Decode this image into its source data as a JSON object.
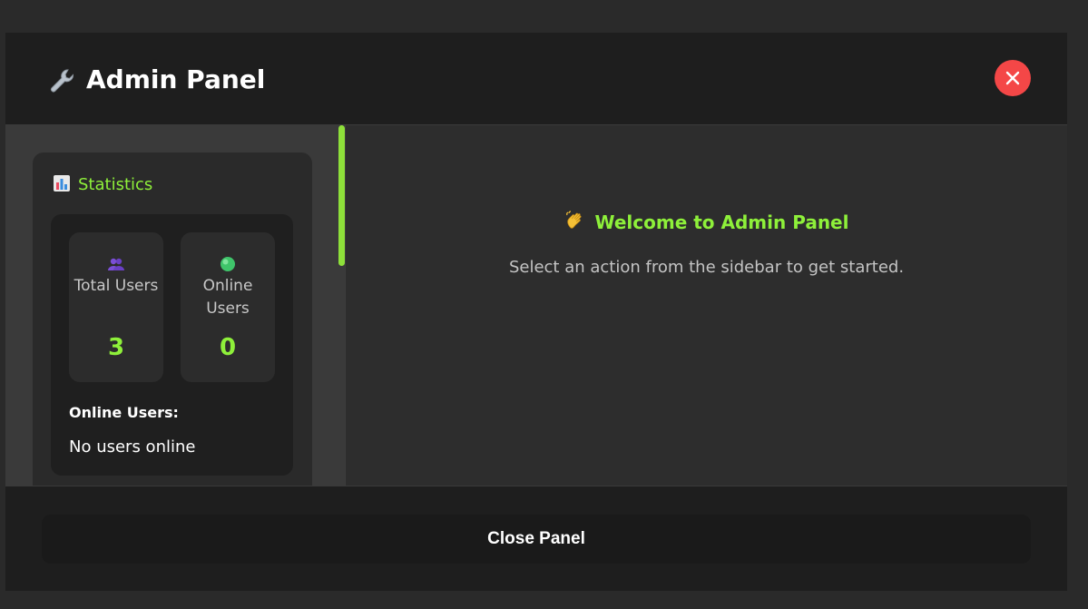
{
  "header": {
    "title": "Admin Panel",
    "icon": "wrench-icon"
  },
  "stats": {
    "title": "Statistics",
    "icon": "bar-chart-icon",
    "total_users": {
      "label": "Total Users",
      "value": "3",
      "icon": "users-icon"
    },
    "online_users": {
      "label": "Online Users",
      "value": "0",
      "icon": "green-circle-icon"
    },
    "online_list_title": "Online Users:",
    "online_list_empty": "No users online"
  },
  "main": {
    "welcome_title": "Welcome to Admin Panel",
    "welcome_icon": "waving-hand-icon",
    "hint": "Select an action from the sidebar to get started."
  },
  "footer": {
    "close_label": "Close Panel"
  },
  "colors": {
    "accent": "#8ef03a",
    "close_button": "#f44747",
    "header_bg": "#1e1e1e",
    "body_bg": "#2d2d2d",
    "sidebar_bg": "#3a3a3a"
  }
}
